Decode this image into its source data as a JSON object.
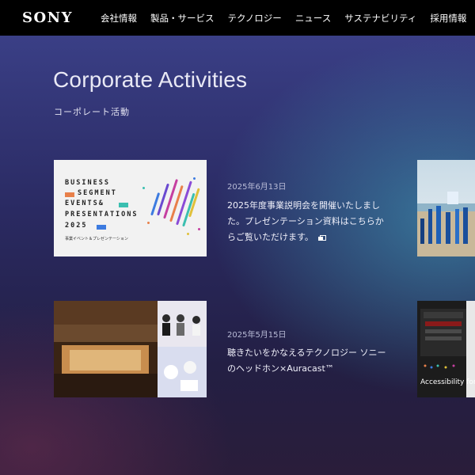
{
  "header": {
    "logo": "SONY",
    "nav": [
      "会社情報",
      "製品・サービス",
      "テクノロジー",
      "ニュース",
      "サステナビリティ",
      "採用情報"
    ]
  },
  "hero": {
    "title": "Corporate Activities",
    "subtitle": "コーポレート活動"
  },
  "cards": [
    {
      "image": {
        "lines": [
          "BUSINESS",
          "SEGMENT",
          "EVENTS&",
          "PRESENTATIONS",
          "2025"
        ],
        "caption": "事業イベント＆プレゼンテーション"
      },
      "date": "2025年6月13日",
      "text": "2025年度事業説明会を開催いたしました。プレゼンテーション資料はこちらからご覧いただけます。"
    },
    {
      "image": {
        "badge": "Accessibility for A"
      },
      "date": "2025年5月15日",
      "text": "聴きたいをかなえるテクノロジー ソニーのヘッドホン×Auracast™"
    }
  ],
  "colors": {
    "accent_orange": "#e8804a",
    "accent_blue": "#3d7be0",
    "accent_teal": "#3bbfb0"
  }
}
